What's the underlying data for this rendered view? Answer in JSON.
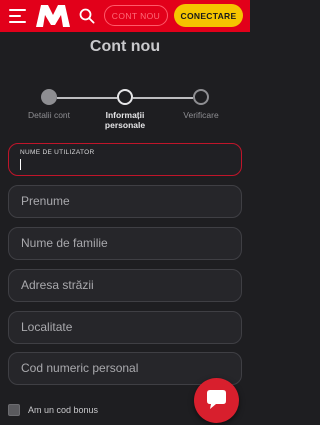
{
  "header": {
    "menu_icon": "hamburger-menu-icon",
    "logo_icon": "brand-m-logo",
    "search_icon": "search-icon",
    "register_label": "CONT NOU",
    "login_label": "CONECTARE",
    "brand_color": "#e2001a",
    "login_color": "#f5c500"
  },
  "page": {
    "title": "Cont nou"
  },
  "steps": [
    {
      "label": "Detalii cont",
      "state": "done"
    },
    {
      "label": "Informații personale",
      "state": "active"
    },
    {
      "label": "Verificare",
      "state": "todo"
    }
  ],
  "form": {
    "username": {
      "label": "NUME DE UTILIZATOR",
      "value": ""
    },
    "first_name": {
      "placeholder": "Prenume"
    },
    "last_name": {
      "placeholder": "Nume de familie"
    },
    "street": {
      "placeholder": "Adresa străzii"
    },
    "city": {
      "placeholder": "Localitate"
    },
    "cnp": {
      "placeholder": "Cod numeric personal"
    },
    "bonus_checkbox_label": "Am un cod bonus",
    "bonus_checked": false
  },
  "chat": {
    "icon": "chat-bubble-icon",
    "color": "#d81f2d"
  }
}
